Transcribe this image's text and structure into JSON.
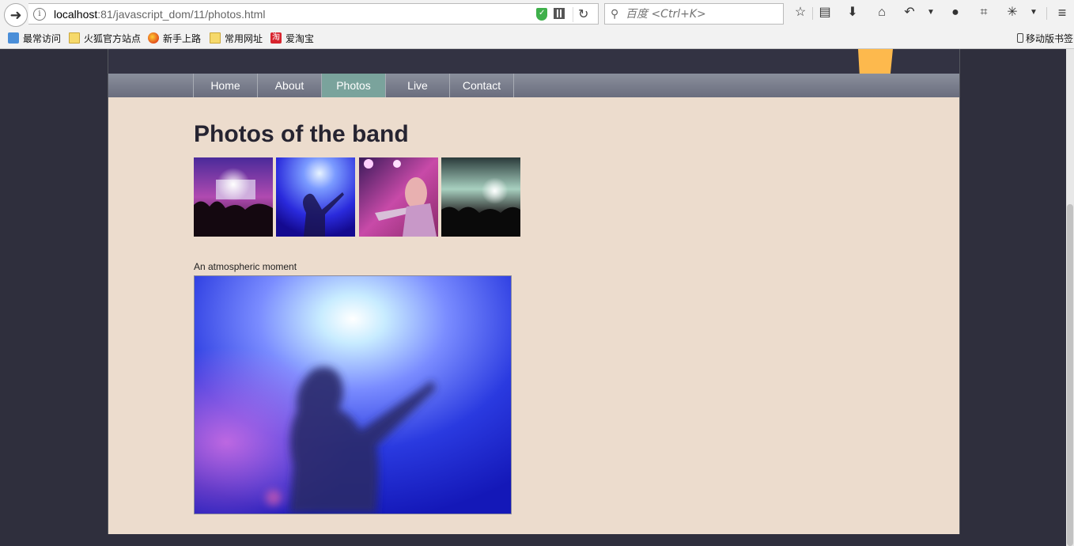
{
  "browser": {
    "url_host": "localhost",
    "url_path": ":81/javascript_dom/11/photos.html",
    "search_placeholder": "百度 <Ctrl+K>",
    "bookmarks": [
      {
        "label": "最常访问",
        "icon": "bookmark-visited-icon"
      },
      {
        "label": "火狐官方站点",
        "icon": "folder-icon"
      },
      {
        "label": "新手上路",
        "icon": "firefox-icon"
      },
      {
        "label": "常用网址",
        "icon": "folder-icon"
      },
      {
        "label": "爱淘宝",
        "icon": "taobao-icon"
      }
    ],
    "taobao_icon_glyph": "淘",
    "mobile_bookmarks": "移动版书签"
  },
  "site": {
    "nav": [
      "Home",
      "About",
      "Photos",
      "Live",
      "Contact"
    ],
    "active_nav": "Photos",
    "accent_color": "#fdb94d",
    "nav_active_color": "#7aa39c"
  },
  "gallery": {
    "title": "Photos of the band",
    "caption": "An atmospheric moment"
  }
}
